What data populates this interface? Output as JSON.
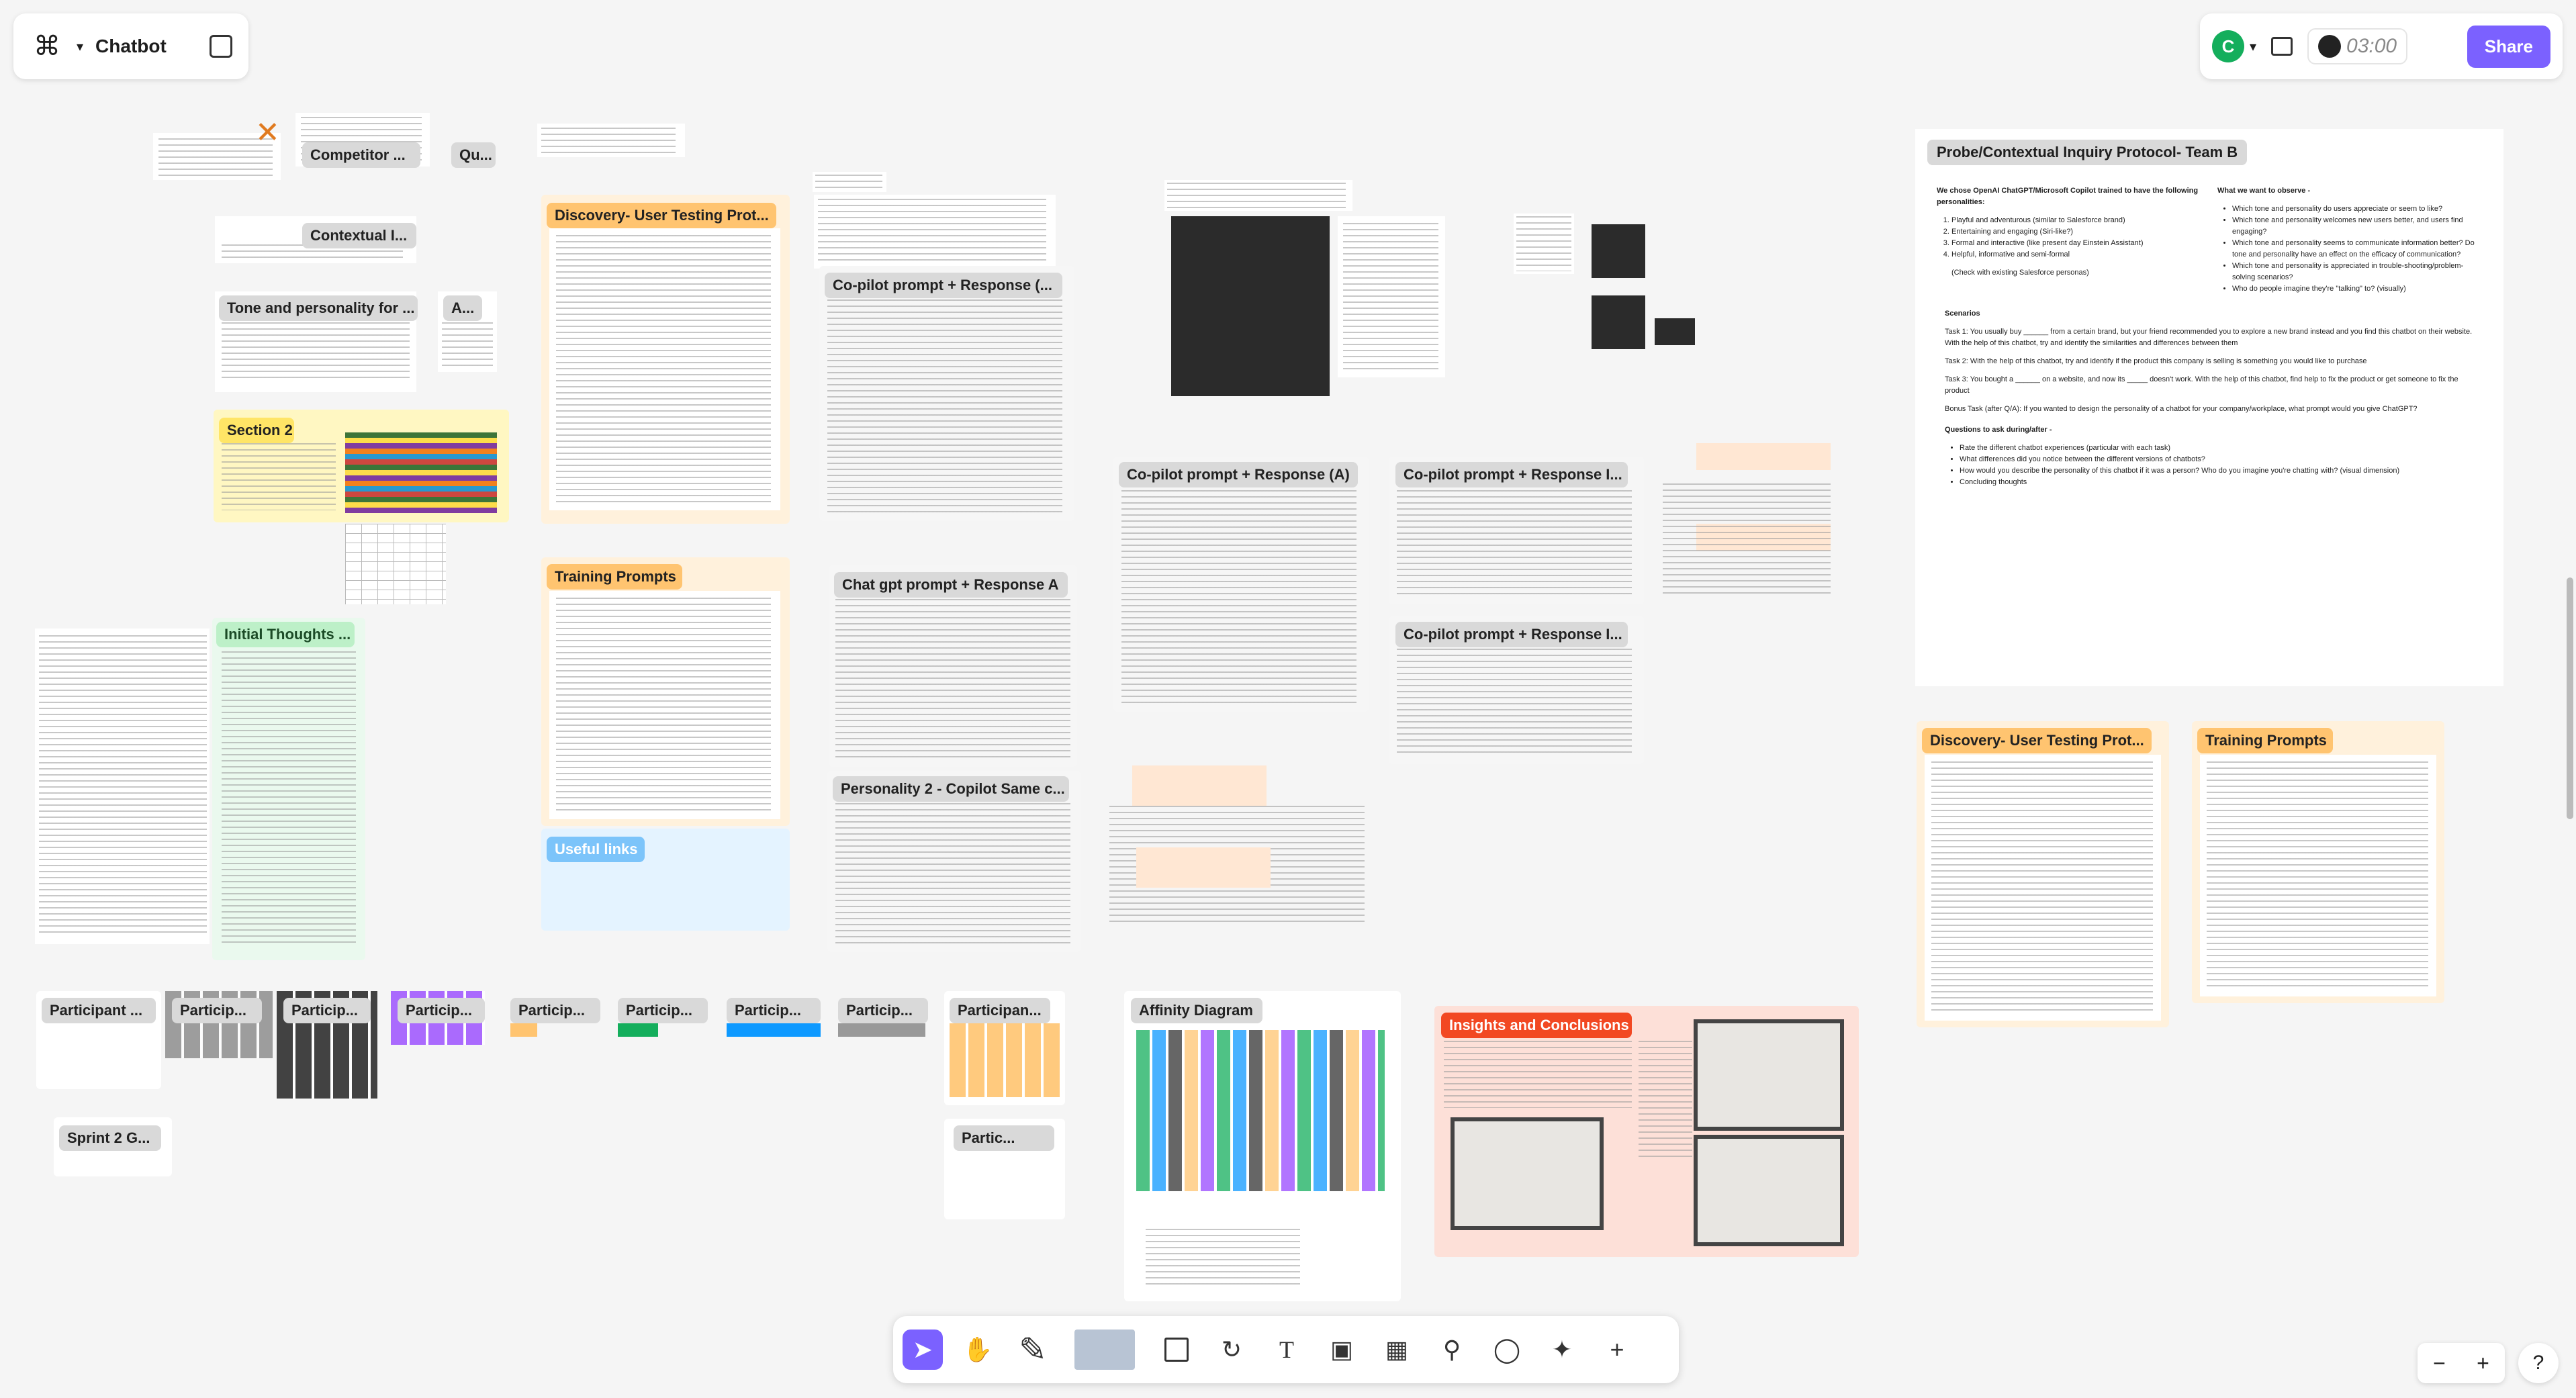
{
  "header": {
    "file_name": "Chatbot",
    "avatar_initial": "C",
    "timer": "03:00",
    "share_label": "Share"
  },
  "sections": {
    "competitor": "Competitor ...",
    "qu": "Qu...",
    "contextual": "Contextual I...",
    "tone": "Tone and personality for ...",
    "a": "A...",
    "section2": "Section 2",
    "initial_thoughts": "Initial Thoughts ...",
    "discovery1": "Discovery- User Testing Prot...",
    "training1": "Training Prompts",
    "useful_links": "Useful links",
    "copilot1": "Co-pilot prompt + Response (...",
    "chatgpt_a": "Chat gpt prompt + Response A",
    "personality2": "Personality 2 - Copilot Same c...",
    "copilot_a": "Co-pilot prompt + Response (A)",
    "copilot_i1": "Co-pilot prompt + Response I...",
    "copilot_i2": "Co-pilot prompt + Response I...",
    "discovery2": "Discovery- User Testing Prot...",
    "training2": "Training Prompts",
    "participant1": "Participant ...",
    "particip1": "Particip...",
    "particip2": "Particip...",
    "particip3": "Particip...",
    "particip4": "Particip...",
    "particip5": "Particip...",
    "particip6": "Particip...",
    "particip7": "Particip...",
    "particip8": "Particip...",
    "partic": "Partic...",
    "participan": "Participan...",
    "sprint": "Sprint 2 G...",
    "affinity": "Affinity Diagram",
    "insights": "Insights and Conclusions"
  },
  "probe": {
    "title": "Probe/Contextual Inquiry Protocol- Team B",
    "intro": "We chose OpenAI ChatGPT/Microsoft Copilot trained to have the following personalities:",
    "personalities": [
      "Playful and adventurous (similar to Salesforce brand)",
      "Entertaining and engaging (Siri-like?)",
      "Formal and interactive (like present day Einstein Assistant)",
      "Helpful, informative and semi-formal"
    ],
    "check_note": "(Check with existing Salesforce personas)",
    "observe_title": "What we want to observe -",
    "observe": [
      "Which tone and personality do users appreciate or seem to like?",
      "Which tone and personality welcomes new users better, and users find engaging?",
      "Which tone and personality seems to communicate information better? Do tone and personality have an effect on the efficacy of communication?",
      "Which tone and personality is appreciated in trouble-shooting/problem-solving scenarios?",
      "Who do people imagine they're \"talking\" to? (visually)"
    ],
    "scenarios_title": "Scenarios",
    "task1": "Task 1: You usually buy ______ from a certain brand, but your friend recommended you to explore a new brand instead and you find this chatbot on their website. With the help of this chatbot, try and identify the similarities and differences between them",
    "task2": "Task 2: With the help of this chatbot, try and identify if the product this company is selling is something you would like to purchase",
    "task3": "Task 3: You bought a ______ on a website, and now its _____ doesn't work. With the help of this chatbot, find help to fix the product or get someone to fix the product",
    "bonus": "Bonus Task (after Q/A): If you wanted to design the personality of a chatbot for your company/workplace, what prompt would you give ChatGPT?",
    "questions_title": "Questions to ask during/after -",
    "questions": [
      "Rate the different chatbot experiences (particular with each task)",
      "What differences did you notice between the different versions of chatbots?",
      "How would you describe the personality of this chatbot if it was a person? Who do you imagine you're chatting with? (visual dimension)",
      "Concluding thoughts"
    ]
  },
  "toolbar": {
    "tools": [
      "move-tool",
      "hand-tool",
      "pen-tool",
      "shape-tool",
      "connector-tool",
      "text-tool",
      "section-tool",
      "table-tool",
      "stamp-tool",
      "comment-tool",
      "actions-tool",
      "more-tool"
    ]
  },
  "zoom": {
    "minus": "−",
    "plus": "+"
  },
  "help": "?"
}
